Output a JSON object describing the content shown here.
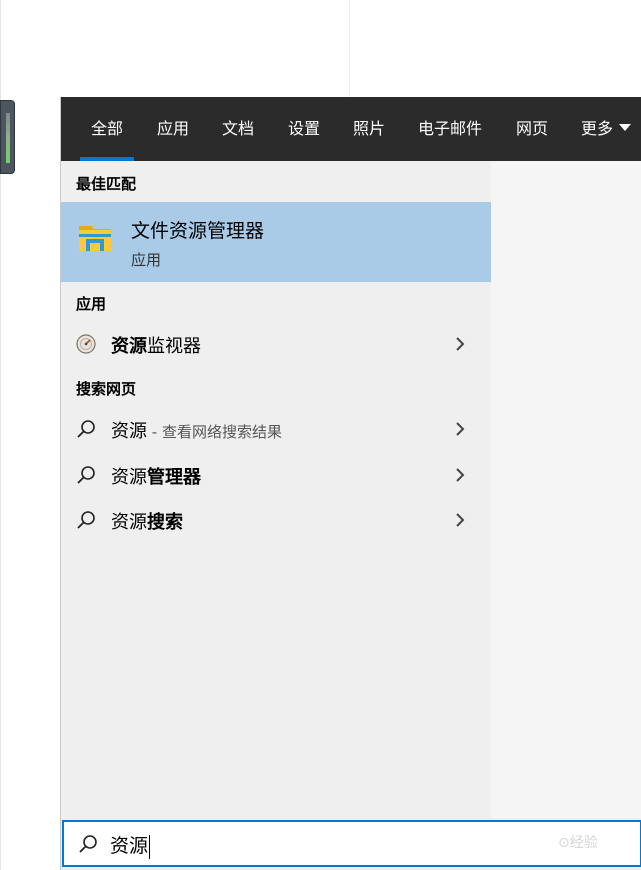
{
  "tabs": [
    {
      "label": "全部",
      "active": true
    },
    {
      "label": "应用"
    },
    {
      "label": "文档"
    },
    {
      "label": "设置"
    },
    {
      "label": "照片"
    },
    {
      "label": "电子邮件"
    },
    {
      "label": "网页"
    },
    {
      "label": "更多"
    }
  ],
  "sections": {
    "best_match": "最佳匹配",
    "apps": "应用",
    "web": "搜索网页"
  },
  "best_match": {
    "title": "文件资源管理器",
    "subtitle": "应用",
    "icon": "folder-icon"
  },
  "app_result": {
    "bold": "资源",
    "rest": "监视器",
    "icon": "resource-monitor-icon"
  },
  "web_results": [
    {
      "plain": "资源",
      "bold": "",
      "hint": " - 查看网络搜索结果"
    },
    {
      "plain": "资源",
      "bold": "管理器",
      "hint": ""
    },
    {
      "plain": "资源",
      "bold": "搜索",
      "hint": ""
    }
  ],
  "search": {
    "value": "资源",
    "icon": "search-icon"
  },
  "watermark": "　⊙经验",
  "colors": {
    "accent": "#0078d7",
    "tabbar": "#2b2b2b",
    "selected": "#a9cbe8"
  }
}
